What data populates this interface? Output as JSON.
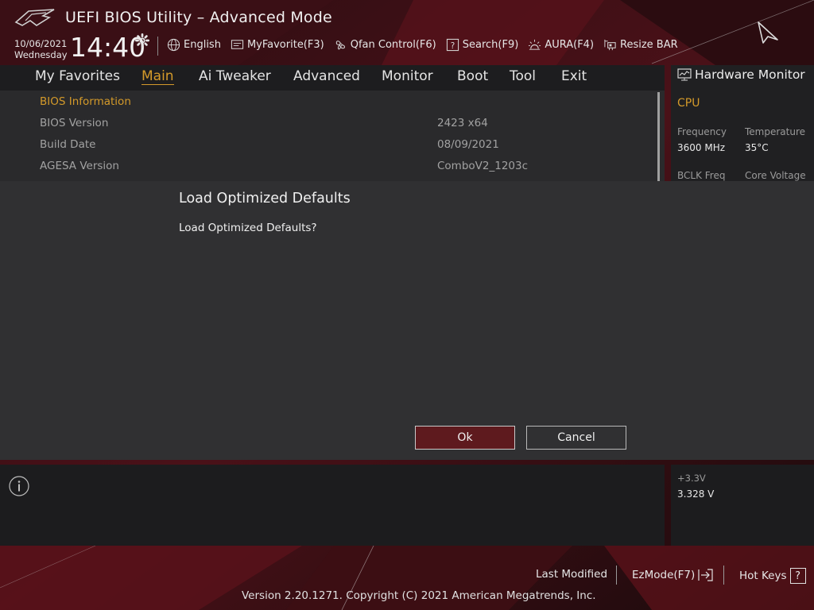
{
  "header": {
    "title": "UEFI BIOS Utility – Advanced Mode",
    "date": "10/06/2021",
    "weekday": "Wednesday",
    "time": "14:40",
    "tools": [
      {
        "label": "English",
        "icon": "globe-icon"
      },
      {
        "label": "MyFavorite(F3)",
        "icon": "favorite-icon"
      },
      {
        "label": "Qfan Control(F6)",
        "icon": "fan-icon"
      },
      {
        "label": "Search(F9)",
        "icon": "search-help-icon"
      },
      {
        "label": "AURA(F4)",
        "icon": "aura-icon"
      },
      {
        "label": "Resize BAR",
        "icon": "resize-bar-icon"
      }
    ]
  },
  "nav": {
    "tabs": [
      "My Favorites",
      "Main",
      "Ai Tweaker",
      "Advanced",
      "Monitor",
      "Boot",
      "Tool",
      "Exit"
    ],
    "active": "Main"
  },
  "main": {
    "section_title": "BIOS Information",
    "rows": [
      {
        "label": "BIOS Version",
        "value": "2423  x64"
      },
      {
        "label": "Build Date",
        "value": "08/09/2021"
      },
      {
        "label": "AGESA Version",
        "value": "ComboV2_1203c"
      }
    ]
  },
  "hardware_monitor": {
    "title": "Hardware Monitor",
    "cpu_label": "CPU",
    "frequency_label": "Frequency",
    "frequency_value": "3600 MHz",
    "temperature_label": "Temperature",
    "temperature_value": "35°C",
    "bclk_label": "BCLK Freq",
    "core_voltage_label": "Core Voltage",
    "v33_label": "+3.3V",
    "v33_value": "3.328 V"
  },
  "dialog": {
    "title": "Load Optimized Defaults",
    "message": "Load Optimized Defaults?",
    "ok_label": "Ok",
    "cancel_label": "Cancel"
  },
  "footer": {
    "last_modified": "Last Modified",
    "ezmode": "EzMode(F7)",
    "hot_keys": "Hot Keys",
    "hot_keys_symbol": "?",
    "copyright": "Version 2.20.1271. Copyright (C) 2021 American Megatrends, Inc."
  },
  "colors": {
    "accent": "#d49a2a",
    "ok_button": "#5e1a1e",
    "background": "#140b0d"
  }
}
